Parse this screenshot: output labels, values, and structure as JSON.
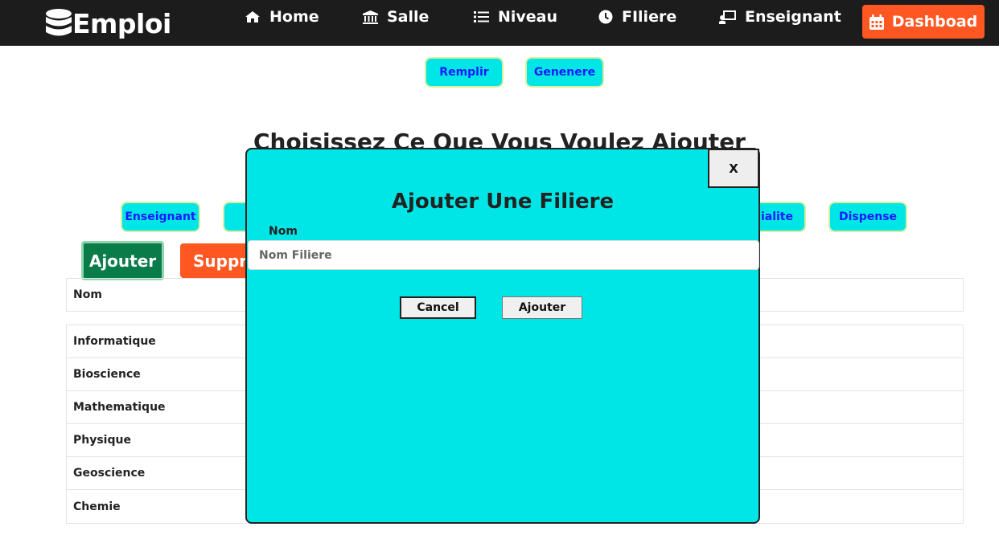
{
  "navbar": {
    "brand": "Emploi",
    "items": [
      {
        "label": "Home",
        "icon": "home-icon"
      },
      {
        "label": "Salle",
        "icon": "bank-icon"
      },
      {
        "label": "Niveau",
        "icon": "list-icon"
      },
      {
        "label": "FIliere",
        "icon": "clock-icon"
      },
      {
        "label": "Enseignant",
        "icon": "teacher-icon"
      }
    ],
    "dashboard_label": "Dashboad",
    "colors": {
      "bar": "#1c1c1c",
      "dashboard": "#ff5722"
    }
  },
  "actions": {
    "remplir": "Remplir",
    "genenere": "Genenere"
  },
  "main": {
    "title": "Choisissez Ce Que Vous Voulez Ajouter",
    "categories": [
      "Enseignant",
      "Specialite",
      "Dispense"
    ],
    "ajouter_label": "Ajouter",
    "supprimer_label": "Supprimer"
  },
  "table": {
    "header": "Nom",
    "rows": [
      "Informatique",
      "Bioscience",
      "Mathematique",
      "Physique",
      "Geoscience",
      "Chemie"
    ]
  },
  "modal": {
    "close_label": "X",
    "title": "Ajouter Une Filiere",
    "field_label": "Nom",
    "field_placeholder": "Nom Filiere",
    "field_value": "",
    "cancel_label": "Cancel",
    "submit_label": "Ajouter",
    "background_color": "#00e5e5"
  }
}
